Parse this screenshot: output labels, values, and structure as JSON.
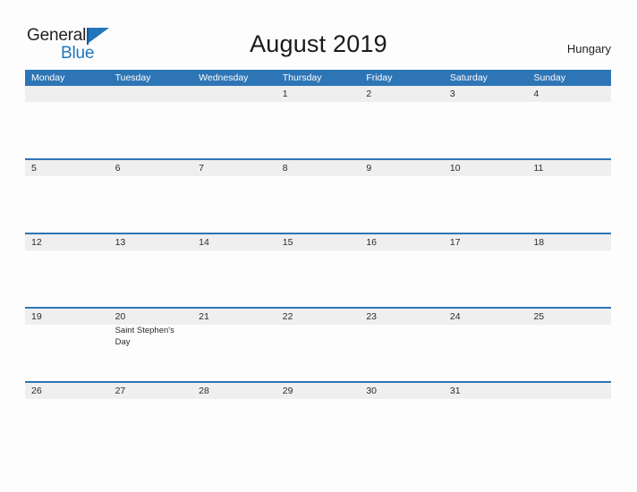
{
  "brand": {
    "name_part1": "General",
    "name_part2": "Blue",
    "flag_icon": "blue-flag-icon",
    "color_dark": "#231f20",
    "color_blue": "#1f76bc"
  },
  "header": {
    "title": "August 2019",
    "locale": "Hungary"
  },
  "calendar": {
    "accent_color": "#2e75b6",
    "band_color": "#efefef",
    "day_names": [
      "Monday",
      "Tuesday",
      "Wednesday",
      "Thursday",
      "Friday",
      "Saturday",
      "Sunday"
    ],
    "weeks": [
      {
        "days": [
          {
            "num": "",
            "event": ""
          },
          {
            "num": "",
            "event": ""
          },
          {
            "num": "",
            "event": ""
          },
          {
            "num": "1",
            "event": ""
          },
          {
            "num": "2",
            "event": ""
          },
          {
            "num": "3",
            "event": ""
          },
          {
            "num": "4",
            "event": ""
          }
        ]
      },
      {
        "days": [
          {
            "num": "5",
            "event": ""
          },
          {
            "num": "6",
            "event": ""
          },
          {
            "num": "7",
            "event": ""
          },
          {
            "num": "8",
            "event": ""
          },
          {
            "num": "9",
            "event": ""
          },
          {
            "num": "10",
            "event": ""
          },
          {
            "num": "11",
            "event": ""
          }
        ]
      },
      {
        "days": [
          {
            "num": "12",
            "event": ""
          },
          {
            "num": "13",
            "event": ""
          },
          {
            "num": "14",
            "event": ""
          },
          {
            "num": "15",
            "event": ""
          },
          {
            "num": "16",
            "event": ""
          },
          {
            "num": "17",
            "event": ""
          },
          {
            "num": "18",
            "event": ""
          }
        ]
      },
      {
        "days": [
          {
            "num": "19",
            "event": ""
          },
          {
            "num": "20",
            "event": "Saint Stephen's Day"
          },
          {
            "num": "21",
            "event": ""
          },
          {
            "num": "22",
            "event": ""
          },
          {
            "num": "23",
            "event": ""
          },
          {
            "num": "24",
            "event": ""
          },
          {
            "num": "25",
            "event": ""
          }
        ]
      },
      {
        "days": [
          {
            "num": "26",
            "event": ""
          },
          {
            "num": "27",
            "event": ""
          },
          {
            "num": "28",
            "event": ""
          },
          {
            "num": "29",
            "event": ""
          },
          {
            "num": "30",
            "event": ""
          },
          {
            "num": "31",
            "event": ""
          },
          {
            "num": "",
            "event": ""
          }
        ]
      }
    ]
  }
}
